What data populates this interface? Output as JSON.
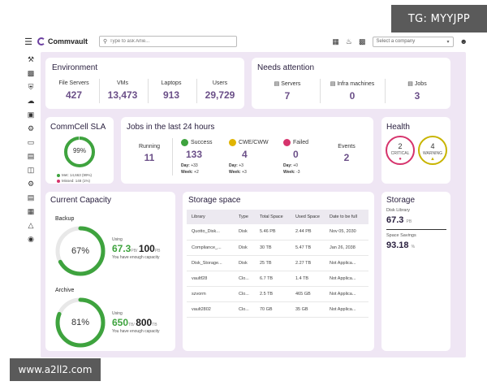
{
  "watermarks": {
    "top": "TG: MYYJPP",
    "bottom": "www.a2ll2.com"
  },
  "header": {
    "app_name": "Commvault",
    "search_placeholder": "Type to ask Arlie...",
    "company_select": "Select a company",
    "icons": [
      "menu-icon",
      "report-icon",
      "bell-icon",
      "grid-icon",
      "user-icon"
    ]
  },
  "sidebar": {
    "icons": [
      "tools-icon",
      "chart-icon",
      "shield-icon",
      "cloud-icon",
      "briefcase-icon",
      "dashboard-icon",
      "monitor-icon",
      "database-icon",
      "network-icon",
      "settings-icon",
      "report-icon",
      "apps-icon",
      "cube-icon",
      "package-icon"
    ]
  },
  "environment": {
    "title": "Environment",
    "stats": [
      {
        "label": "File Servers",
        "value": "427"
      },
      {
        "label": "VMs",
        "value": "13,473"
      },
      {
        "label": "Laptops",
        "value": "913"
      },
      {
        "label": "Users",
        "value": "29,729"
      }
    ]
  },
  "attention": {
    "title": "Needs attention",
    "stats": [
      {
        "label": "Servers",
        "value": "7"
      },
      {
        "label": "Infra machines",
        "value": "0"
      },
      {
        "label": "Jobs",
        "value": "3"
      }
    ]
  },
  "sla": {
    "title": "CommCell SLA",
    "percent": "99%",
    "percent_value": 0.99,
    "met": "Met: 14,663 (99%)",
    "missed": "Missed: 148 (1%)",
    "colors": {
      "met": "#3ea33e",
      "missed": "#d6336c"
    }
  },
  "jobs": {
    "title": "Jobs in the last 24 hours",
    "running": {
      "label": "Running",
      "value": "11"
    },
    "success": {
      "label": "Success",
      "value": "133",
      "day": "+33",
      "week": "+2",
      "color": "#3ea33e"
    },
    "cwe": {
      "label": "CWE/CWW",
      "value": "4",
      "day": "+3",
      "week": "+3",
      "color": "#e0b400"
    },
    "failed": {
      "label": "Failed",
      "value": "0",
      "day": "+0",
      "week": "-3",
      "color": "#d6336c"
    },
    "events": {
      "label": "Events",
      "value": "2"
    },
    "day_label": "Day:",
    "week_label": "Week:"
  },
  "health": {
    "title": "Health",
    "critical": {
      "value": "2",
      "label": "CRITICAL",
      "color": "#d6336c"
    },
    "warning": {
      "value": "4",
      "label": "WARNING",
      "color": "#c8b400"
    }
  },
  "capacity": {
    "title": "Current Capacity",
    "backup": {
      "label": "Backup",
      "percent": "67%",
      "fraction": 0.67,
      "using_label": "Using",
      "used": "67.3",
      "used_unit": "PB/",
      "total": "100",
      "total_unit": "PB",
      "note": "You have enough capacity"
    },
    "archive": {
      "label": "Archive",
      "percent": "81%",
      "fraction": 0.81,
      "using_label": "Using",
      "used": "650",
      "used_unit": "TB/",
      "total": "800",
      "total_unit": "TB",
      "note": "You have enough capacity"
    }
  },
  "storage_space": {
    "title": "Storage space",
    "columns": [
      "Library",
      "Type",
      "Total Space",
      "Used Space",
      "Date to be full"
    ],
    "rows": [
      [
        "Quotto_Disk...",
        "Disk",
        "5.46 PB",
        "2.44 PB",
        "Nov 05, 2030"
      ],
      [
        "Compliance_...",
        "Disk",
        "30 TB",
        "5.47 TB",
        "Jan 26, 2038"
      ],
      [
        "Disk_Storage...",
        "Disk",
        "25 TB",
        "2.27 TB",
        "Not Applica..."
      ],
      [
        "vaultf28",
        "Clo...",
        "6.7 TB",
        "1.4 TB",
        "Not Applica..."
      ],
      [
        "szvorm",
        "Clo...",
        "2.5 TB",
        "465 GB",
        "Not Applica..."
      ],
      [
        "vault2802",
        "Clo...",
        "70 GB",
        "35 GB",
        "Not Applica..."
      ]
    ]
  },
  "storage": {
    "title": "Storage",
    "disk_library_label": "Disk Library",
    "disk_library_value": "67.3",
    "disk_library_unit": "PB",
    "savings_label": "Space Savings",
    "savings_value": "93.18",
    "savings_unit": "%"
  }
}
